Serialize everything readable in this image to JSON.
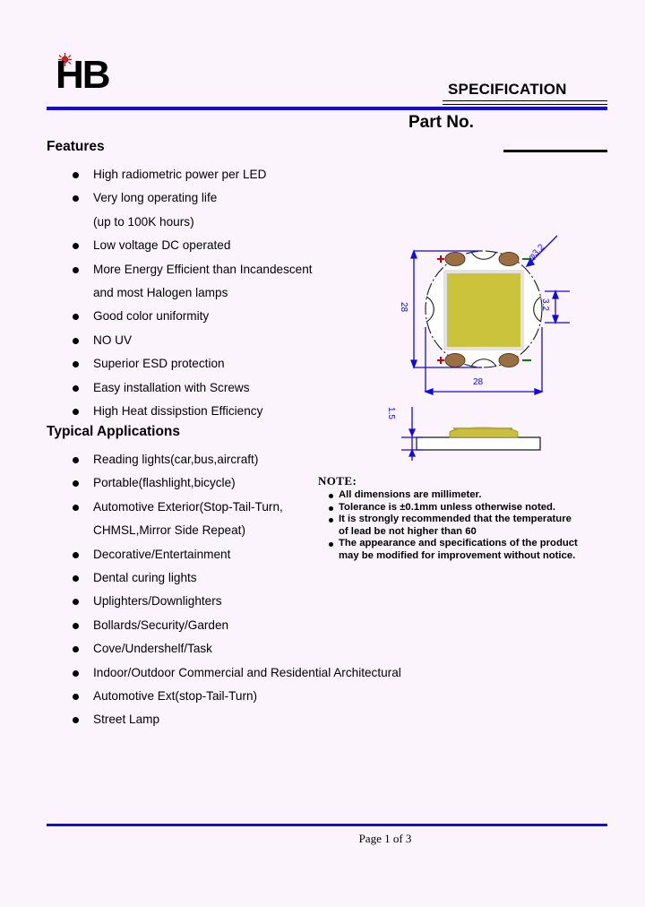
{
  "document": {
    "background_color": "#fbf4fc",
    "accent_color": "#1408e0"
  },
  "header": {
    "logo_text": "HB",
    "logo_icon": "red-sun-starburst-icon",
    "logo_accent_color": "#b01a1a",
    "spec_title": "SPECIFICATION",
    "part_no_label": "Part No."
  },
  "features": {
    "heading": "Features",
    "items": [
      {
        "text": "High radiometric power per LED",
        "continuation": false
      },
      {
        "text": "Very long operating life",
        "continuation": false
      },
      {
        "text": "(up to 100K hours)",
        "continuation": true
      },
      {
        "text": "Low voltage DC operated",
        "continuation": false
      },
      {
        "text": "More Energy Efficient than Incandescent",
        "continuation": false
      },
      {
        "text": "and most Halogen lamps",
        "continuation": true
      },
      {
        "text": "Good color uniformity",
        "continuation": false
      },
      {
        "text": "NO UV",
        "continuation": false
      },
      {
        "text": "Superior ESD protection",
        "continuation": false
      },
      {
        "text": "Easy installation with Screws",
        "continuation": false
      },
      {
        "text": "High Heat dissipstion Efficiency",
        "continuation": false
      }
    ]
  },
  "applications": {
    "heading": "Typical Applications",
    "items": [
      {
        "text": "Reading lights(car,bus,aircraft)",
        "continuation": false
      },
      {
        "text": "Portable(flashlight,bicycle)",
        "continuation": false
      },
      {
        "text": "Automotive Exterior(Stop-Tail-Turn,",
        "continuation": false
      },
      {
        "text": "CHMSL,Mirror Side Repeat)",
        "continuation": true
      },
      {
        "text": "Decorative/Entertainment",
        "continuation": false
      },
      {
        "text": "Dental curing lights",
        "continuation": false
      },
      {
        "text": "Uplighters/Downlighters",
        "continuation": false
      },
      {
        "text": "Bollards/Security/Garden",
        "continuation": false
      },
      {
        "text": "Cove/Undershelf/Task",
        "continuation": false
      },
      {
        "text": "Indoor/Outdoor Commercial and Residential Architectural",
        "continuation": false
      },
      {
        "text": "Automotive Ext(stop-Tail-Turn)",
        "continuation": false
      },
      {
        "text": "Street Lamp",
        "continuation": false
      }
    ]
  },
  "note": {
    "title": "NOTE:",
    "items": [
      {
        "main": "All dimensions are millimeter.",
        "sub": ""
      },
      {
        "main": "Tolerance is ±0.1mm unless otherwise noted.",
        "sub": ""
      },
      {
        "main": "It is strongly recommended that the temperature",
        "sub": "of lead be not higher than 60"
      },
      {
        "main": "The appearance and specifications of the product",
        "sub": "may be modified for improvement without notice."
      }
    ]
  },
  "drawing": {
    "top_view": {
      "width_dim": "28",
      "height_dim": "28",
      "hole_dim": "φ3.2",
      "pad_hole_dim": "3.2",
      "polarity_plus": "+",
      "polarity_minus": "−",
      "phosphor_color": "#ccc33d",
      "pad_color": "#9a7042",
      "body_color": "#ffffff",
      "plus_color": "#cc0000",
      "minus_color": "#008000"
    },
    "side_view": {
      "thickness_dim": "1.5",
      "substrate_color": "#ffffff",
      "dome_color": "#ccc33d"
    }
  },
  "footer": {
    "page_text": "Page 1 of 3"
  }
}
